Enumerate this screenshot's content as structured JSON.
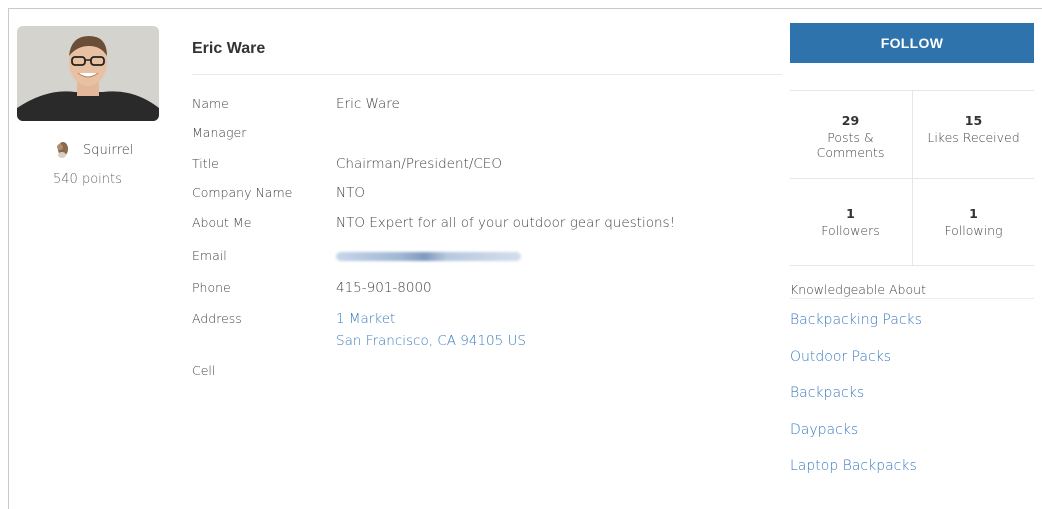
{
  "profile": {
    "rank_label": "Squirrel",
    "points": "540 points",
    "name": "Eric Ware"
  },
  "details": [
    {
      "label": "Name",
      "value": "Eric Ware",
      "link": false
    },
    {
      "label": "Manager",
      "value": "",
      "link": false
    },
    {
      "label": "Title",
      "value": "Chairman/President/CEO",
      "link": false
    },
    {
      "label": "Company Name",
      "value": "NTO",
      "link": false
    },
    {
      "label": "About Me",
      "value": "NTO Expert for all of your outdoor gear questions!",
      "link": false
    },
    {
      "label": "Email",
      "value": "",
      "link": true
    },
    {
      "label": "Phone",
      "value": "415-901-8000",
      "link": false
    },
    {
      "label": "Address",
      "value": "1 Market",
      "value2": "San Francisco, CA 94105 US",
      "link": true
    },
    {
      "label": "Cell",
      "value": "",
      "link": false
    }
  ],
  "actions": {
    "follow_label": "FOLLOW"
  },
  "stats": {
    "posts": {
      "num": "29",
      "label": "Posts &",
      "label2": "Comments"
    },
    "likes": {
      "num": "15",
      "label": "Likes Received"
    },
    "followers": {
      "num": "1",
      "label": "Followers"
    },
    "following": {
      "num": "1",
      "label": "Following"
    }
  },
  "knowledge": {
    "title": "Knowledgeable About",
    "topics": [
      "Backpacking Packs",
      "Outdoor Packs",
      "Backpacks",
      "Daypacks",
      "Laptop Backpacks"
    ]
  },
  "colors": {
    "accent": "#2e73ac",
    "link": "#3b7bbf"
  }
}
